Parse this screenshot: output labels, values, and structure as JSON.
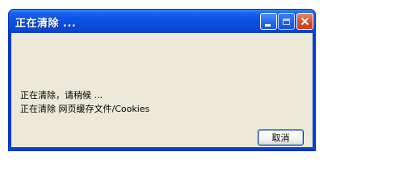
{
  "window": {
    "title": "正在清除 ...",
    "buttons": {
      "minimize": "minimize-icon",
      "maximize": "maximize-icon",
      "close": "close-icon"
    }
  },
  "messages": {
    "line1": "正在清除，请稍候 ...",
    "line2": "正在清除 网页缓存文件/Cookies"
  },
  "actions": {
    "cancel_label": "取消"
  },
  "colors": {
    "titlebar": "#0a4ede",
    "client": "#ece9d8",
    "close_button": "#d9512a"
  }
}
